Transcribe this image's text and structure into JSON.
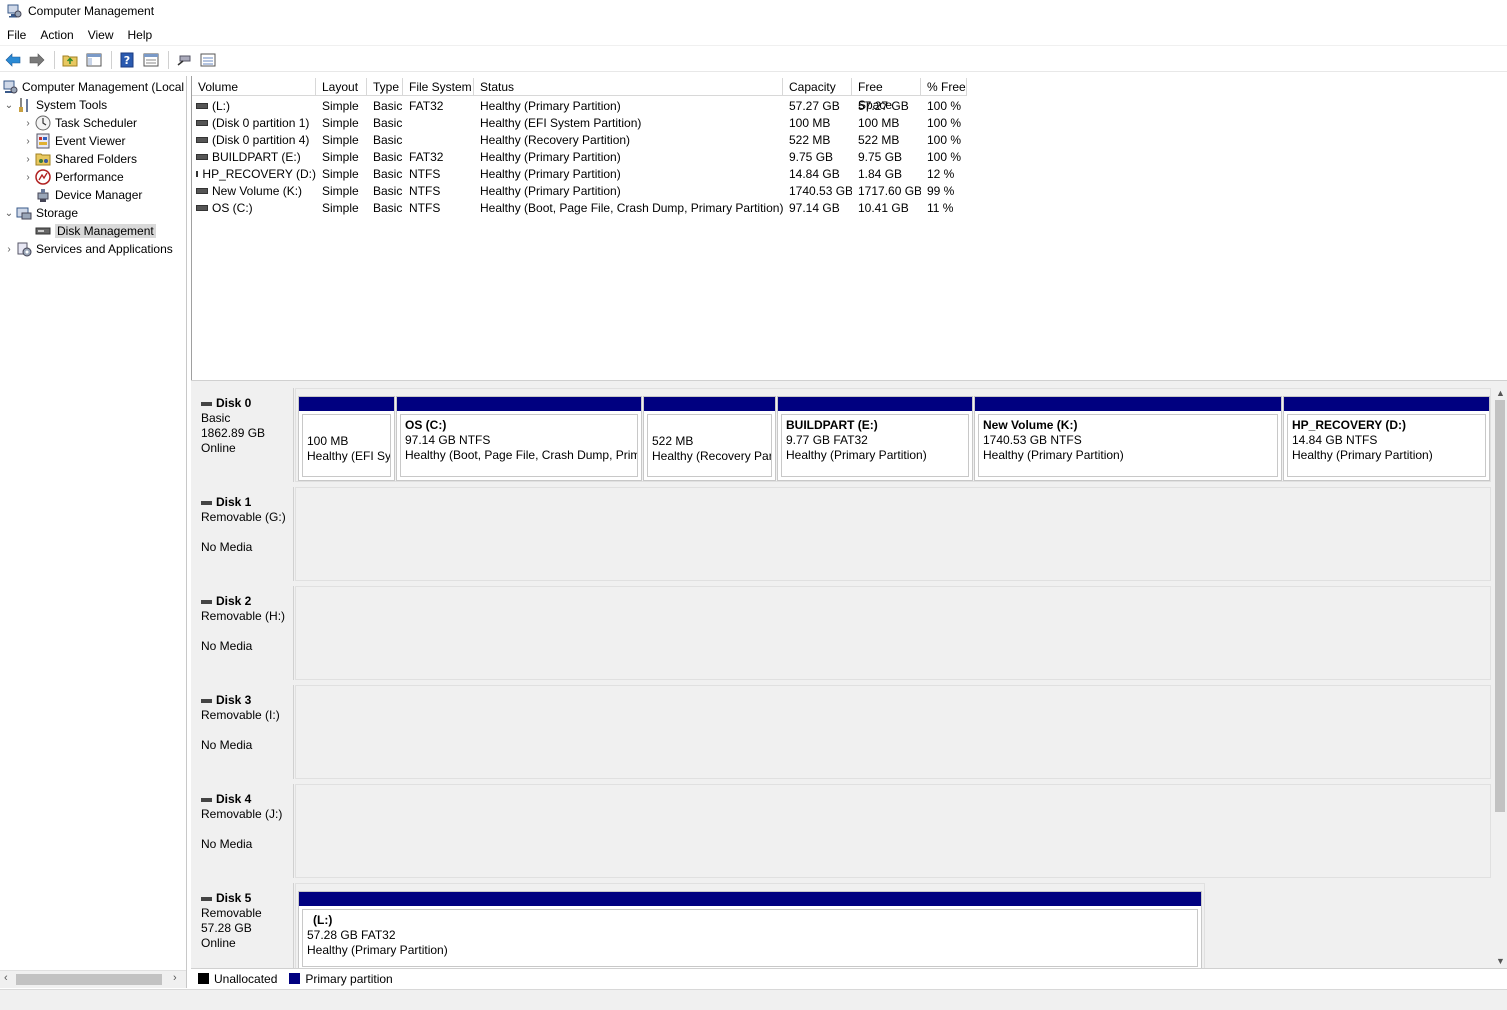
{
  "window": {
    "title": "Computer Management"
  },
  "menu": [
    "File",
    "Action",
    "View",
    "Help"
  ],
  "toolbar": [
    "back-arrow-icon",
    "forward-arrow-icon",
    "folder-up-icon",
    "show-hide-tree-icon",
    "help-icon",
    "properties-icon",
    "connect-icon",
    "list-view-icon"
  ],
  "tree": {
    "root": "Computer Management (Local",
    "system_tools": "System Tools",
    "task_scheduler": "Task Scheduler",
    "event_viewer": "Event Viewer",
    "shared_folders": "Shared Folders",
    "performance": "Performance",
    "device_manager": "Device Manager",
    "storage": "Storage",
    "disk_management": "Disk Management",
    "services": "Services and Applications"
  },
  "volumes": {
    "columns": [
      "Volume",
      "Layout",
      "Type",
      "File System",
      "Status",
      "Capacity",
      "Free Space",
      "% Free"
    ],
    "rows": [
      [
        "(L:)",
        "Simple",
        "Basic",
        "FAT32",
        "Healthy (Primary Partition)",
        "57.27 GB",
        "57.27 GB",
        "100 %"
      ],
      [
        "(Disk 0 partition 1)",
        "Simple",
        "Basic",
        "",
        "Healthy (EFI System Partition)",
        "100 MB",
        "100 MB",
        "100 %"
      ],
      [
        "(Disk 0 partition 4)",
        "Simple",
        "Basic",
        "",
        "Healthy (Recovery Partition)",
        "522 MB",
        "522 MB",
        "100 %"
      ],
      [
        "BUILDPART (E:)",
        "Simple",
        "Basic",
        "FAT32",
        "Healthy (Primary Partition)",
        "9.75 GB",
        "9.75 GB",
        "100 %"
      ],
      [
        "HP_RECOVERY (D:)",
        "Simple",
        "Basic",
        "NTFS",
        "Healthy (Primary Partition)",
        "14.84 GB",
        "1.84 GB",
        "12 %"
      ],
      [
        "New Volume (K:)",
        "Simple",
        "Basic",
        "NTFS",
        "Healthy (Primary Partition)",
        "1740.53 GB",
        "1717.60 GB",
        "99 %"
      ],
      [
        "OS (C:)",
        "Simple",
        "Basic",
        "NTFS",
        "Healthy (Boot, Page File, Crash Dump, Primary Partition)",
        "97.14 GB",
        "10.41 GB",
        "11 %"
      ]
    ]
  },
  "disks": {
    "disk0": {
      "name": "Disk 0",
      "type": "Basic",
      "size": "1862.89 GB",
      "status": "Online",
      "partitions": [
        {
          "name": "",
          "size": "100 MB",
          "status": "Healthy (EFI Sys"
        },
        {
          "name": "OS  (C:)",
          "size": "97.14 GB NTFS",
          "status": "Healthy (Boot, Page File, Crash Dump, Prima"
        },
        {
          "name": "",
          "size": "522 MB",
          "status": "Healthy (Recovery Part"
        },
        {
          "name": "BUILDPART  (E:)",
          "size": "9.77 GB FAT32",
          "status": "Healthy (Primary Partition)"
        },
        {
          "name": "New Volume  (K:)",
          "size": "1740.53 GB NTFS",
          "status": "Healthy (Primary Partition)"
        },
        {
          "name": "HP_RECOVERY  (D:)",
          "size": "14.84 GB NTFS",
          "status": "Healthy (Primary Partition)"
        }
      ]
    },
    "disk1": {
      "name": "Disk 1",
      "type": "Removable (G:)",
      "status": "No Media"
    },
    "disk2": {
      "name": "Disk 2",
      "type": "Removable (H:)",
      "status": "No Media"
    },
    "disk3": {
      "name": "Disk 3",
      "type": "Removable (I:)",
      "status": "No Media"
    },
    "disk4": {
      "name": "Disk 4",
      "type": "Removable (J:)",
      "status": "No Media"
    },
    "disk5": {
      "name": "Disk 5",
      "type": "Removable",
      "size": "57.28 GB",
      "status": "Online",
      "partitions": [
        {
          "name": "(L:)",
          "size": "57.28 GB FAT32",
          "status": "Healthy (Primary Partition)"
        }
      ]
    }
  },
  "legend": {
    "unallocated": "Unallocated",
    "primary": "Primary partition",
    "unallocated_color": "#000000",
    "primary_color": "#000080"
  }
}
